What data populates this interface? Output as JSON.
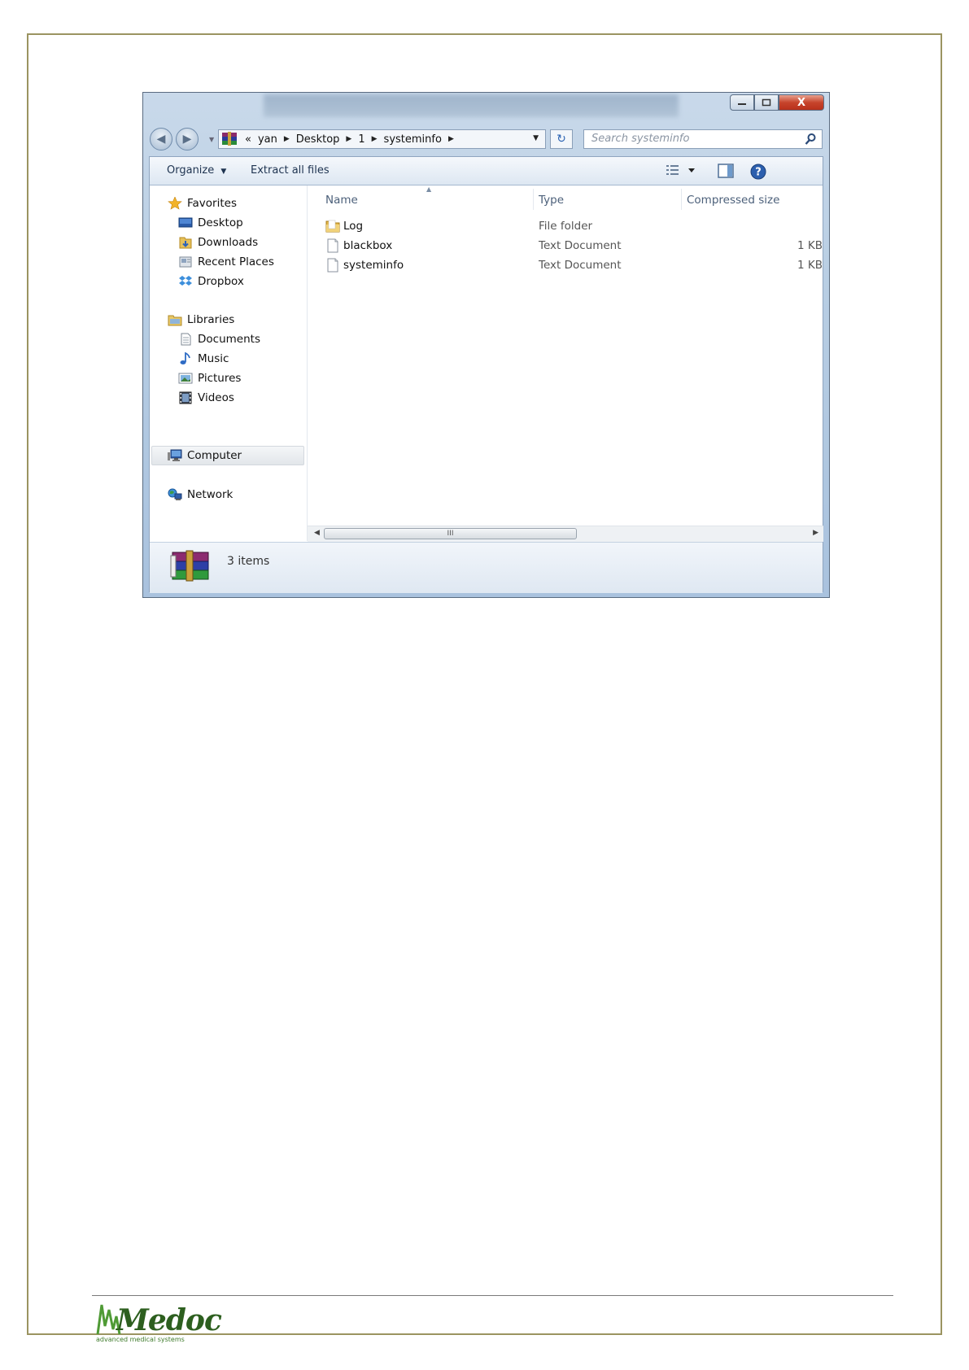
{
  "window": {
    "search_placeholder": "Search systeminfo",
    "address": {
      "overflow": "«",
      "segments": [
        "yan",
        "Desktop",
        "1",
        "systeminfo"
      ]
    },
    "caption": {
      "close_glyph": "X"
    }
  },
  "toolbar": {
    "organize_label": "Organize",
    "extract_label": "Extract all files"
  },
  "nav": {
    "favorites": {
      "label": "Favorites",
      "items": [
        "Desktop",
        "Downloads",
        "Recent Places",
        "Dropbox"
      ]
    },
    "libraries": {
      "label": "Libraries",
      "items": [
        "Documents",
        "Music",
        "Pictures",
        "Videos"
      ]
    },
    "computer_label": "Computer",
    "network_label": "Network"
  },
  "columns": {
    "name": "Name",
    "type": "Type",
    "size": "Compressed size"
  },
  "files": [
    {
      "name": "Log",
      "type": "File folder",
      "size": "",
      "icon": "folder-icon"
    },
    {
      "name": "blackbox",
      "type": "Text Document",
      "size": "1 KB",
      "icon": "text-file-icon"
    },
    {
      "name": "systeminfo",
      "type": "Text Document",
      "size": "1 KB",
      "icon": "text-file-icon"
    }
  ],
  "status": {
    "item_count": "3 items"
  },
  "scrollbar": {
    "grip": "III"
  },
  "logo": {
    "word": "Medoc",
    "tagline": "advanced medical systems"
  },
  "colors": {
    "frame": "#9b9461",
    "logo_green": "#2d5f1f",
    "close_red": "#c7442c"
  }
}
